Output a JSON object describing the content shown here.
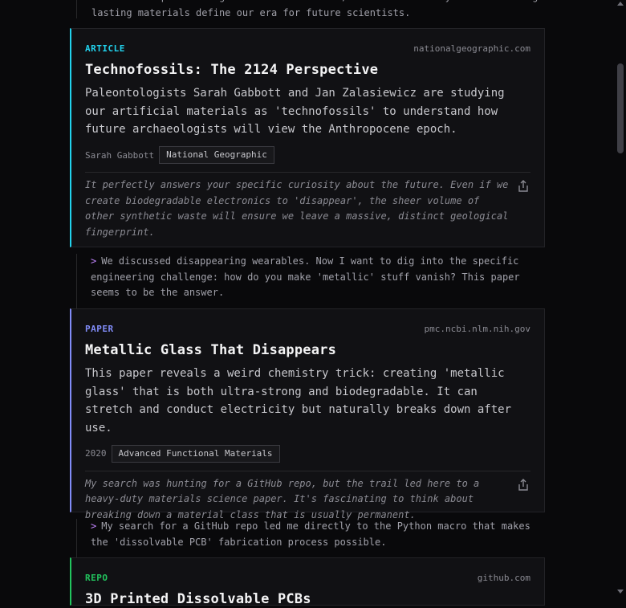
{
  "top_note": {
    "text": "found this specific angle on 'technofossils,' which is exactly about how long lasting materials define our era for future scientists."
  },
  "cards": [
    {
      "kind": "ARTICLE",
      "domain": "nationalgeographic.com",
      "title": "Technofossils: The 2124 Perspective",
      "summary": "Paleontologists Sarah Gabbott and Jan Zalasiewicz are studying our artificial materials as 'technofossils' to understand how future archaeologists will view the Anthropocene epoch.",
      "author": "Sarah Gabbott",
      "tag": "National Geographic",
      "comment": "It perfectly answers your specific curiosity about the future. Even if we create biodegradable electronics to 'disappear', the sheer volume of other synthetic waste will ensure we leave a massive, distinct geological fingerprint.",
      "accent": "#22d3ee"
    },
    {
      "kind": "PAPER",
      "domain": "pmc.ncbi.nlm.nih.gov",
      "title": "Metallic Glass That Disappears",
      "summary": "This paper reveals a weird chemistry trick: creating 'metallic glass' that is both ultra-strong and biodegradable. It can stretch and conduct electricity but naturally breaks down after use.",
      "author": "2020",
      "tag": "Advanced Functional Materials",
      "comment": "My search was hunting for a GitHub repo, but the trail led here to a heavy-duty materials science paper. It's fascinating to think about breaking down a material class that is usually permanent.",
      "accent": "#818cf8"
    },
    {
      "kind": "REPO",
      "domain": "github.com",
      "title": "3D Printed Dissolvable PCBs",
      "accent": "#22c55e"
    }
  ],
  "notes": [
    {
      "prompt": ">",
      "text": "We discussed disappearing wearables. Now I want to dig into the specific engineering challenge: how do you make 'metallic' stuff vanish? This paper seems to be the answer."
    },
    {
      "prompt": ">",
      "text": "My search for a GitHub repo led me directly to the Python macro that makes the 'dissolvable PCB' fabrication process possible."
    }
  ],
  "icons": {
    "share": "share-icon"
  }
}
